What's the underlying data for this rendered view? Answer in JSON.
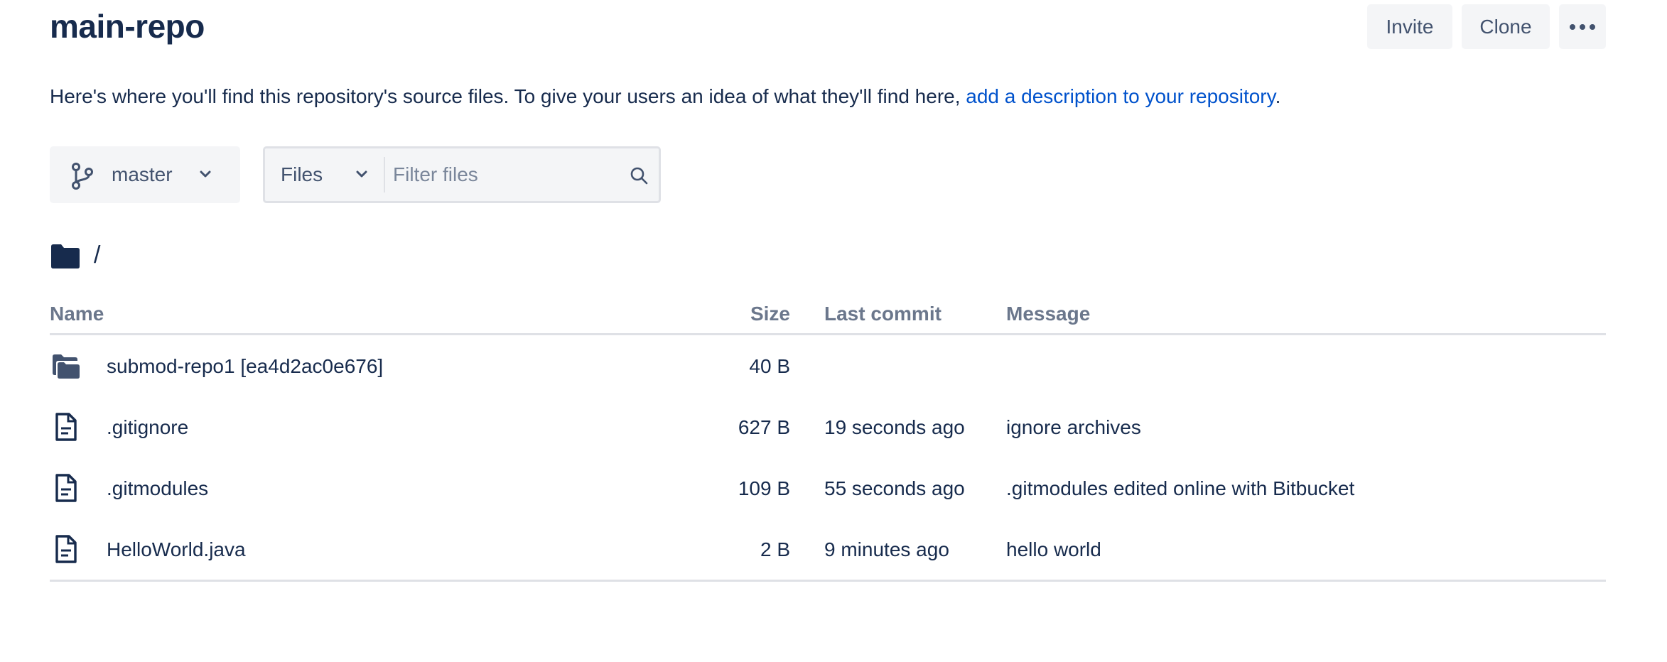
{
  "repo": {
    "title": "main-repo"
  },
  "header_actions": {
    "invite_label": "Invite",
    "clone_label": "Clone",
    "more_icon": "more-horizontal-icon"
  },
  "description": {
    "text": "Here's where you'll find this repository's source files. To give your users an idea of what they'll find here, ",
    "link_text": "add a description to your repository",
    "suffix": "."
  },
  "toolbar": {
    "branch_label": "master",
    "files_label": "Files",
    "filter_placeholder": "Filter files"
  },
  "breadcrumb": {
    "path": "/"
  },
  "table": {
    "columns": {
      "name": "Name",
      "size": "Size",
      "last_commit": "Last commit",
      "message": "Message"
    },
    "rows": [
      {
        "icon": "submodule-folder-icon",
        "name": "submod-repo1 [ea4d2ac0e676]",
        "size": "40 B",
        "last_commit": "",
        "message": ""
      },
      {
        "icon": "file-icon",
        "name": ".gitignore",
        "size": "627 B",
        "last_commit": "19 seconds ago",
        "message": "ignore archives"
      },
      {
        "icon": "file-icon",
        "name": ".gitmodules",
        "size": "109 B",
        "last_commit": "55 seconds ago",
        "message": ".gitmodules edited online with Bitbucket"
      },
      {
        "icon": "file-icon",
        "name": "HelloWorld.java",
        "size": "2 B",
        "last_commit": "9 minutes ago",
        "message": "hello world"
      }
    ]
  },
  "colors": {
    "text": "#172b4d",
    "link": "#0052cc",
    "muted": "#6b778c",
    "button_bg": "#f4f5f7",
    "border": "#dfe1e6"
  }
}
